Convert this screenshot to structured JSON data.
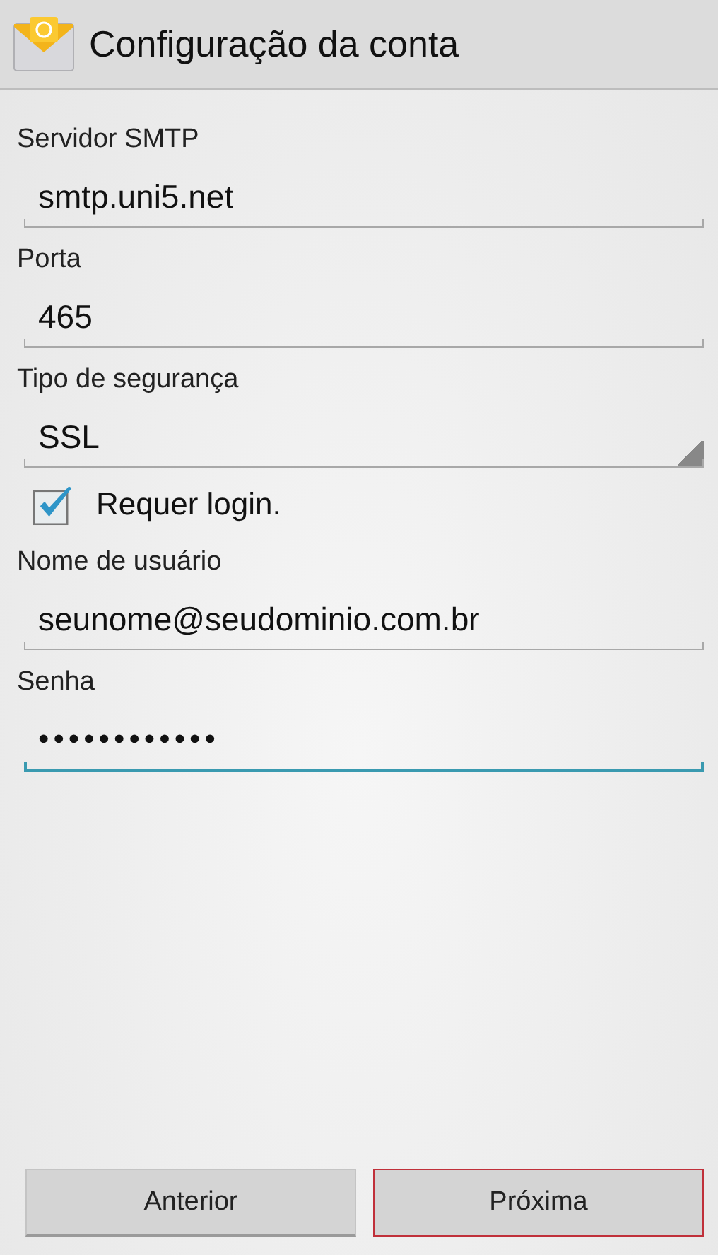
{
  "header": {
    "title": "Configuração da conta"
  },
  "fields": [
    {
      "kind": "text",
      "label": "Servidor SMTP",
      "value": "smtp.uni5.net",
      "focused": false
    },
    {
      "kind": "text",
      "label": "Porta",
      "value": "465",
      "focused": false
    },
    {
      "kind": "dropdown",
      "label": "Tipo de segurança",
      "value": "SSL",
      "focused": false
    },
    {
      "kind": "checkbox",
      "label": "Requer login.",
      "checked": true
    },
    {
      "kind": "text",
      "label": "Nome de usuário",
      "value": "seunome@seudominio.com.br",
      "focused": false
    },
    {
      "kind": "password",
      "label": "Senha",
      "value": "••••••••••••",
      "focused": true
    }
  ],
  "buttons": [
    {
      "label": "Anterior",
      "focused": false
    },
    {
      "label": "Próxima",
      "focused": true
    }
  ]
}
